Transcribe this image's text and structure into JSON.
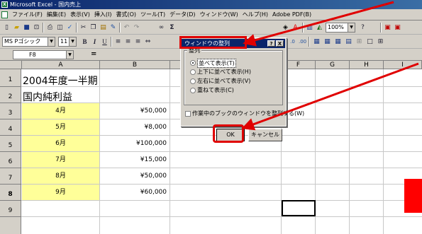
{
  "window": {
    "title": "Microsoft Excel - 国内売上",
    "app_icon": "excel-icon",
    "app_icon_text": "X"
  },
  "menubar": {
    "items": [
      "ファイル(F)",
      "編集(E)",
      "表示(V)",
      "挿入(I)",
      "書式(O)",
      "ツール(T)",
      "データ(D)",
      "ウィンドウ(W)",
      "ヘルプ(H)",
      "Adobe PDF(B)"
    ]
  },
  "toolbar1": {
    "zoom": "100%",
    "icons": [
      "new-icon",
      "open-icon",
      "save-icon",
      "permission-icon",
      "print-icon",
      "print-preview-icon",
      "spellcheck-icon",
      "cut-icon",
      "copy-icon",
      "paste-icon",
      "format-painter-icon",
      "undo-icon",
      "redo-icon"
    ]
  },
  "toolbar2": {
    "font_name": "MS Pゴシック",
    "font_size": "11",
    "bold": "B",
    "italic": "I",
    "underline": "U"
  },
  "formula_bar": {
    "name_box": "F8",
    "equals": "="
  },
  "columns": [
    "A",
    "B",
    "F",
    "G",
    "H",
    "I"
  ],
  "rows": [
    "1",
    "2",
    "3",
    "4",
    "5",
    "6",
    "7",
    "8",
    "9"
  ],
  "sheet": {
    "a1": "2004年度一半期",
    "a2": "国内純利益",
    "months": [
      "4月",
      "5月",
      "6月",
      "7月",
      "8月",
      "9月"
    ],
    "amounts": [
      "¥50,000",
      "¥8,000",
      "¥100,000",
      "¥15,000",
      "¥50,000",
      "¥60,000"
    ]
  },
  "dialog": {
    "title": "ウィンドウの整列",
    "help": "?",
    "close": "X",
    "group_label": "整列",
    "options": [
      "並べて表示(T)",
      "上下に並べて表示(H)",
      "左右に並べて表示(V)",
      "重ねて表示(C)"
    ],
    "selected_option": "並べて表示(T)",
    "checkbox_label": "作業中のブックのウィンドウを整列する(W)",
    "ok": "OK",
    "cancel": "キャンセル"
  },
  "colors": {
    "highlight_cell": "#ffff99",
    "annotation_red": "#e00000",
    "titlebar": "#0a246a"
  }
}
